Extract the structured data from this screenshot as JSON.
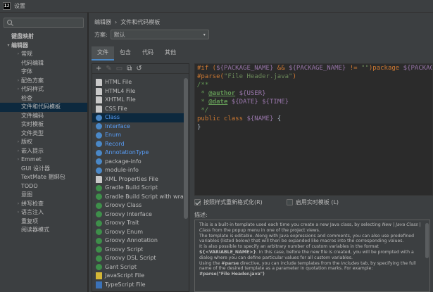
{
  "window": {
    "title": "设置",
    "app_icon_text": "IJ"
  },
  "search": {
    "placeholder": "",
    "value": ""
  },
  "sidebar": {
    "items": [
      {
        "label": "键盘映射",
        "level": 0,
        "arrow": "",
        "bold": true,
        "selected": false
      },
      {
        "label": "编辑器",
        "level": 0,
        "arrow": "▾",
        "bold": true,
        "selected": false
      },
      {
        "label": "常规",
        "level": 1,
        "arrow": "›",
        "bold": false,
        "selected": false
      },
      {
        "label": "代码编辑",
        "level": 1,
        "arrow": "",
        "bold": false,
        "selected": false
      },
      {
        "label": "字体",
        "level": 1,
        "arrow": "",
        "bold": false,
        "selected": false
      },
      {
        "label": "配色方案",
        "level": 1,
        "arrow": "›",
        "bold": false,
        "selected": false
      },
      {
        "label": "代码样式",
        "level": 1,
        "arrow": "›",
        "bold": false,
        "selected": false
      },
      {
        "label": "检查",
        "level": 1,
        "arrow": "",
        "bold": false,
        "selected": false
      },
      {
        "label": "文件和代码模板",
        "level": 1,
        "arrow": "",
        "bold": false,
        "selected": true
      },
      {
        "label": "文件编码",
        "level": 1,
        "arrow": "",
        "bold": false,
        "selected": false
      },
      {
        "label": "实时模板",
        "level": 1,
        "arrow": "",
        "bold": false,
        "selected": false
      },
      {
        "label": "文件类型",
        "level": 1,
        "arrow": "",
        "bold": false,
        "selected": false
      },
      {
        "label": "版权",
        "level": 1,
        "arrow": "›",
        "bold": false,
        "selected": false
      },
      {
        "label": "嵌入提示",
        "level": 1,
        "arrow": "›",
        "bold": false,
        "selected": false
      },
      {
        "label": "Emmet",
        "level": 1,
        "arrow": "›",
        "bold": false,
        "selected": false
      },
      {
        "label": "GUI 设计器",
        "level": 1,
        "arrow": "",
        "bold": false,
        "selected": false
      },
      {
        "label": "TextMate 捆绑包",
        "level": 1,
        "arrow": "",
        "bold": false,
        "selected": false
      },
      {
        "label": "TODO",
        "level": 1,
        "arrow": "",
        "bold": false,
        "selected": false
      },
      {
        "label": "意图",
        "level": 1,
        "arrow": "",
        "bold": false,
        "selected": false
      },
      {
        "label": "拼写检查",
        "level": 1,
        "arrow": "›",
        "bold": false,
        "selected": false
      },
      {
        "label": "语言注入",
        "level": 1,
        "arrow": "›",
        "bold": false,
        "selected": false
      },
      {
        "label": "重复项",
        "level": 1,
        "arrow": "",
        "bold": false,
        "selected": false
      },
      {
        "label": "阅读器模式",
        "level": 1,
        "arrow": "",
        "bold": false,
        "selected": false
      }
    ]
  },
  "breadcrumb": {
    "parent": "编辑器",
    "separator": "›",
    "current": "文件和代码模板"
  },
  "scheme": {
    "label": "方案:",
    "value": "默认",
    "caret": "▾"
  },
  "tabs": [
    {
      "label": "文件",
      "active": true
    },
    {
      "label": "包含",
      "active": false
    },
    {
      "label": "代码",
      "active": false
    },
    {
      "label": "其他",
      "active": false
    }
  ],
  "toolbar": {
    "add": "+",
    "remove": "✎",
    "copy": "▭",
    "duplicate": "⧉",
    "reset": "↺"
  },
  "templates": [
    {
      "label": "HTML File",
      "icon": "file",
      "color": "normal",
      "selected": false
    },
    {
      "label": "HTML4 File",
      "icon": "file",
      "color": "normal",
      "selected": false
    },
    {
      "label": "XHTML File",
      "icon": "file",
      "color": "normal",
      "selected": false
    },
    {
      "label": "CSS File",
      "icon": "file",
      "color": "normal",
      "selected": false
    },
    {
      "label": "Class",
      "icon": "java",
      "color": "blue",
      "selected": true
    },
    {
      "label": "Interface",
      "icon": "java",
      "color": "blue",
      "selected": false
    },
    {
      "label": "Enum",
      "icon": "java",
      "color": "blue",
      "selected": false
    },
    {
      "label": "Record",
      "icon": "java",
      "color": "blue",
      "selected": false
    },
    {
      "label": "AnnotationType",
      "icon": "java",
      "color": "blue",
      "selected": false
    },
    {
      "label": "package-info",
      "icon": "java",
      "color": "normal",
      "selected": false
    },
    {
      "label": "module-info",
      "icon": "java",
      "color": "normal",
      "selected": false
    },
    {
      "label": "XML Properties File",
      "icon": "file",
      "color": "normal",
      "selected": false
    },
    {
      "label": "Gradle Build Script",
      "icon": "green",
      "color": "normal",
      "selected": false
    },
    {
      "label": "Gradle Build Script with wrapper",
      "icon": "green",
      "color": "normal",
      "selected": false
    },
    {
      "label": "Groovy Class",
      "icon": "green",
      "color": "normal",
      "selected": false
    },
    {
      "label": "Groovy Interface",
      "icon": "green",
      "color": "normal",
      "selected": false
    },
    {
      "label": "Groovy Trait",
      "icon": "green",
      "color": "normal",
      "selected": false
    },
    {
      "label": "Groovy Enum",
      "icon": "green",
      "color": "normal",
      "selected": false
    },
    {
      "label": "Groovy Annotation",
      "icon": "green",
      "color": "normal",
      "selected": false
    },
    {
      "label": "Groovy Script",
      "icon": "green",
      "color": "normal",
      "selected": false
    },
    {
      "label": "Groovy DSL Script",
      "icon": "green",
      "color": "normal",
      "selected": false
    },
    {
      "label": "Gant Script",
      "icon": "green",
      "color": "normal",
      "selected": false
    },
    {
      "label": "JavaScript File",
      "icon": "js",
      "color": "normal",
      "selected": false
    },
    {
      "label": "TypeScript File",
      "icon": "ts",
      "color": "normal",
      "selected": false
    }
  ],
  "editor": {
    "lines": [
      {
        "segments": [
          {
            "t": "#if (",
            "c": "kw"
          },
          {
            "t": "${PACKAGE_NAME}",
            "c": "var"
          },
          {
            "t": " && ",
            "c": "kw"
          },
          {
            "t": "${PACKAGE_NAME}",
            "c": "var"
          },
          {
            "t": " != ",
            "c": "kw"
          },
          {
            "t": "\"\"",
            "c": "str"
          },
          {
            "t": ")",
            "c": "kw"
          },
          {
            "t": "package ",
            "c": "kw"
          },
          {
            "t": "${PACKAGE_NAME}",
            "c": "var"
          },
          {
            "t": ";",
            "c": "plain"
          }
        ]
      },
      {
        "segments": [
          {
            "t": "#parse(",
            "c": "kw"
          },
          {
            "t": "\"File Header.java\"",
            "c": "str"
          },
          {
            "t": ")",
            "c": "kw"
          }
        ]
      },
      {
        "segments": [
          {
            "t": "/**",
            "c": "cmt"
          }
        ]
      },
      {
        "segments": [
          {
            "t": " * ",
            "c": "cmt"
          },
          {
            "t": "@author",
            "c": "tag"
          },
          {
            "t": " ",
            "c": "cmt"
          },
          {
            "t": "${USER}",
            "c": "var"
          }
        ]
      },
      {
        "segments": [
          {
            "t": " * ",
            "c": "cmt"
          },
          {
            "t": "@date",
            "c": "tag"
          },
          {
            "t": " ",
            "c": "cmt"
          },
          {
            "t": "${DATE}",
            "c": "var"
          },
          {
            "t": " ",
            "c": "cmt"
          },
          {
            "t": "${TIME}",
            "c": "var"
          }
        ]
      },
      {
        "segments": [
          {
            "t": " */",
            "c": "cmt"
          }
        ]
      },
      {
        "segments": [
          {
            "t": "public class ",
            "c": "kw"
          },
          {
            "t": "${NAME}",
            "c": "var"
          },
          {
            "t": " {",
            "c": "plain"
          }
        ]
      },
      {
        "segments": [
          {
            "t": "}",
            "c": "plain"
          }
        ]
      }
    ]
  },
  "options": {
    "reformat": {
      "label": "按照样式重新格式化(R)",
      "checked": true
    },
    "live_template": {
      "label": "启用实时模板 (L)",
      "checked": false
    }
  },
  "description": {
    "label": "描述:",
    "paragraphs": [
      [
        {
          "t": "This is a built-in template used each time you create a new Java class, by selecting "
        },
        {
          "t": "New | Java Class | Class",
          "s": "i"
        },
        {
          "t": " from the popup menu in one of the project views."
        }
      ],
      [
        {
          "t": "The template is editable. Along with Java expressions and comments, you can also use predefined variables (listed below) that will then be expanded like macros into the corresponding values."
        }
      ],
      [
        {
          "t": "It is also possible to specify an arbitrary number of custom variables in the format "
        },
        {
          "t": "${<VARIABLE_NAME>}",
          "s": "b"
        },
        {
          "t": ". In this case, before the new file is created, you will be prompted with a dialog where you can define particular values for all custom variables."
        }
      ],
      [
        {
          "t": "Using the "
        },
        {
          "t": "#parse",
          "s": "b"
        },
        {
          "t": " directive, you can include templates from the "
        },
        {
          "t": "Includes",
          "s": "i"
        },
        {
          "t": " tab, by specifying the full name of the desired template as a parameter in quotation marks. For example:"
        }
      ],
      [
        {
          "t": "#parse(\"File Header.java\")",
          "s": "b"
        }
      ]
    ]
  },
  "colors": {
    "accent": "#4a88c7",
    "selection": "#0d293e",
    "panel": "#3c3f41",
    "editor_bg": "#2b2b2b"
  }
}
